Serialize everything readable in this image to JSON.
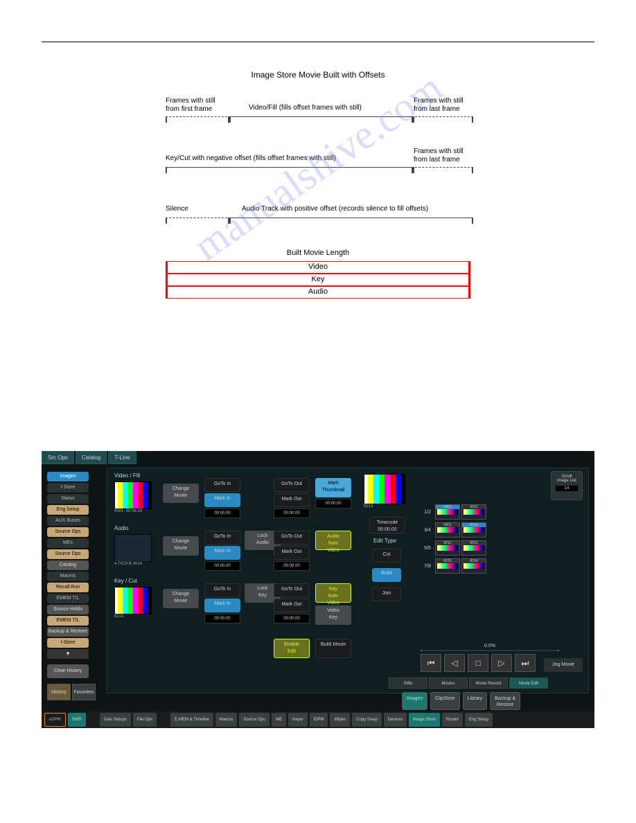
{
  "diagram": {
    "title": "Image Store Movie Built with Offsets",
    "row1_left": "Frames with still\nfrom first frame",
    "row1_mid": "Video/Fill (fills offset frames with still)",
    "row1_right": "Frames with still\nfrom last frame",
    "row2_mid": "Key/Cut with negative offset (fills offset frames with still)",
    "row2_right": "Frames with still\nfrom last frame",
    "row3_left": "Silence",
    "row3_mid": "Audio Track with positive offset (records silence to fill offsets)",
    "built_title": "Built Movie Length",
    "built_tracks": [
      "Video",
      "Key",
      "Audio"
    ]
  },
  "watermark": "manualshive.com",
  "ui": {
    "top_tabs": [
      "Src Ops",
      "Catalog",
      "T-Line"
    ],
    "sidebar": [
      {
        "l": "Images",
        "c": "b-blue"
      },
      {
        "l": "I-Store",
        "c": "b-dark"
      },
      {
        "l": "Status",
        "c": "b-dark"
      },
      {
        "l": "Eng Setup",
        "c": "b-tan"
      },
      {
        "l": "AUX Buses",
        "c": "b-dark"
      },
      {
        "l": "Source Ops",
        "c": "b-tan"
      },
      {
        "l": "MEs",
        "c": "b-dark"
      },
      {
        "l": "Source Ops",
        "c": "b-tan"
      },
      {
        "l": "Catalog",
        "c": "b-gray"
      },
      {
        "l": "Macros",
        "c": "b-dark"
      },
      {
        "l": "Recall Run",
        "c": "b-tan"
      },
      {
        "l": "EMEM T/L",
        "c": "b-dark"
      },
      {
        "l": "Source Holds",
        "c": "b-gray"
      },
      {
        "l": "EMEM T/L",
        "c": "b-tan"
      },
      {
        "l": "Backup & Restore",
        "c": "b-gray"
      },
      {
        "l": "I-Store",
        "c": "b-tan"
      }
    ],
    "clear_history": "Clear History",
    "history": "History",
    "favorites": "Favorites",
    "sections": {
      "video_fill": "Video / Fill",
      "audio": "Audio",
      "key_cut": "Key / Cut"
    },
    "btns": {
      "change_movie": "Change\nMovie",
      "goto_in": "GoTo In",
      "mark_in": "Mark In",
      "goto_out": "GoTo Out",
      "mark_out": "Mark Out",
      "lock_audio": "Lock\nAudio",
      "lock_key": "Lock\nKey",
      "mark_thumbnail": "Mark\nThumbnail",
      "audio_from_video": "Audio\nfrom\nVideo",
      "key_from_video": "Key\nfrom\nVideo",
      "video_key": "Video\nKey",
      "enable_edit": "Enable\nEdit",
      "build_movie": "Build Movie"
    },
    "timecodes": {
      "video_id": "0001",
      "video_tc": "00:06:19",
      "zero": "00:00.00",
      "key_id": "8213"
    },
    "right": {
      "scroll_label": "Scroll\nImage List",
      "scroll_val": "14",
      "timecode_label": "Timecode",
      "timecode_val": "00:00.00",
      "edit_type": "Edit Type",
      "cut": "Cut",
      "build": "Build",
      "join": "Join",
      "preview_id": "8213",
      "rows": [
        "1/2",
        "3/4",
        "5/6",
        "7/8"
      ],
      "thumbs": [
        "0001",
        "0012",
        "0001",
        "0014",
        "8211",
        "8212",
        "8213",
        "8214"
      ],
      "pct": "0.0%",
      "jog": "Jog Movie"
    },
    "sub_tabs": [
      "Stills",
      "Movies",
      "Movie Record",
      "Movie Edit"
    ],
    "mid_tabs": [
      "Images",
      "ClipStore",
      "Library",
      "Backup &\nRestore"
    ],
    "bottom": [
      "eDPM",
      "SWR",
      "",
      "User Setups",
      "File Ops",
      "",
      "E-MEM & Timeline",
      "Macros",
      "Source Ops",
      "ME",
      "Keyer",
      "iDPM",
      "Wipes",
      "Copy Swap",
      "Devices",
      "Image Store",
      "Router",
      "Eng Setup"
    ]
  }
}
